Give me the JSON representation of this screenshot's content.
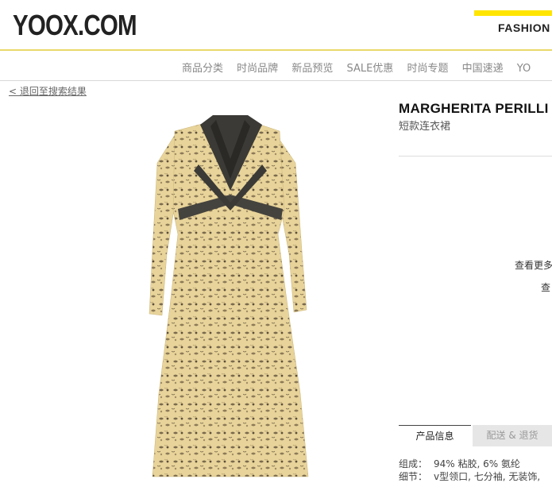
{
  "header": {
    "logo": "YOOX.COM",
    "fashion_tab": "FASHION"
  },
  "nav": {
    "items": [
      "商品分类",
      "时尚品牌",
      "新品预览",
      "SALE优惠",
      "时尚专题",
      "中国速递",
      "YO"
    ]
  },
  "back_link": "< 退回至搜索结果",
  "product": {
    "brand": "MARGHERITA PERILLI",
    "category": "短款连衣裙",
    "more_link_1": "查看更多",
    "more_link_2": "查",
    "tabs": {
      "info": "产品信息",
      "shipping": "配送 & 退货"
    },
    "composition_label": "组成：",
    "composition_value": "94% 粘胶, 6% 氨纶",
    "details_label": "细节：",
    "details_value": "v型领口, 七分袖, 无装饰,"
  },
  "colors": {
    "accent": "#ffe500",
    "dress_base": "#e8d49a",
    "dress_trim": "#3b3a36"
  }
}
